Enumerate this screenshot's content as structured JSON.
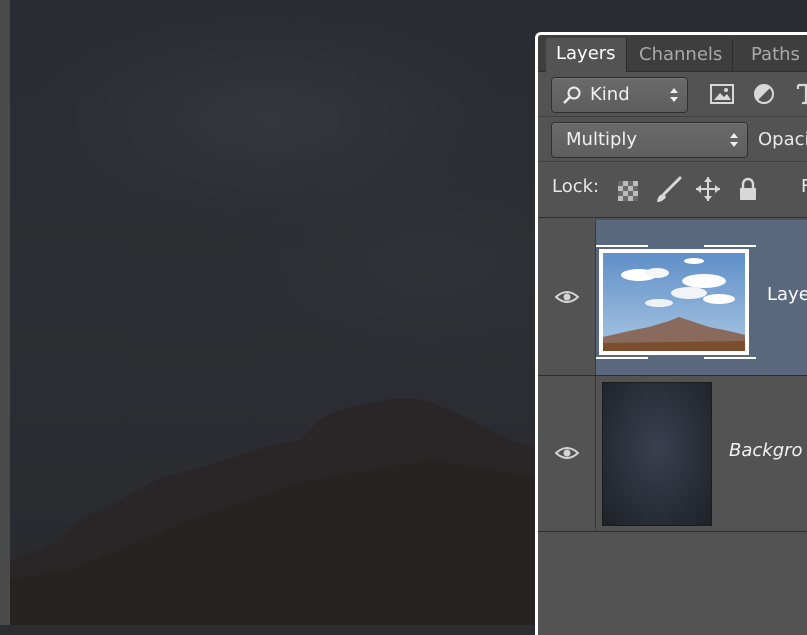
{
  "layers_panel": {
    "tabs": [
      {
        "label": "Layers",
        "active": true
      },
      {
        "label": "Channels",
        "active": false
      },
      {
        "label": "Paths",
        "active": false
      }
    ],
    "filter": {
      "label": "Kind",
      "icons": [
        "search-icon",
        "image-filter-icon",
        "adjustment-filter-icon",
        "type-filter-icon"
      ]
    },
    "blend_mode": {
      "value": "Multiply"
    },
    "opacity_label": "Opaci",
    "lock": {
      "label": "Lock:",
      "icons": [
        "lock-transparent-pixels-icon",
        "lock-image-pixels-icon",
        "lock-position-icon",
        "lock-all-icon"
      ]
    },
    "fill_label_partial": "F",
    "layers": [
      {
        "name": "Laye",
        "visible": true,
        "selected": true,
        "thumbnail": "mountain-sky-photo"
      },
      {
        "name": "Backgro",
        "visible": true,
        "selected": false,
        "italic": true,
        "thumbnail": "dark-gradient"
      }
    ]
  },
  "colors": {
    "panel_bg": "#535353",
    "selected_layer": "#5a687d",
    "tab_bar": "#3e3e3e",
    "canvas_bg": "#2b2d31"
  }
}
